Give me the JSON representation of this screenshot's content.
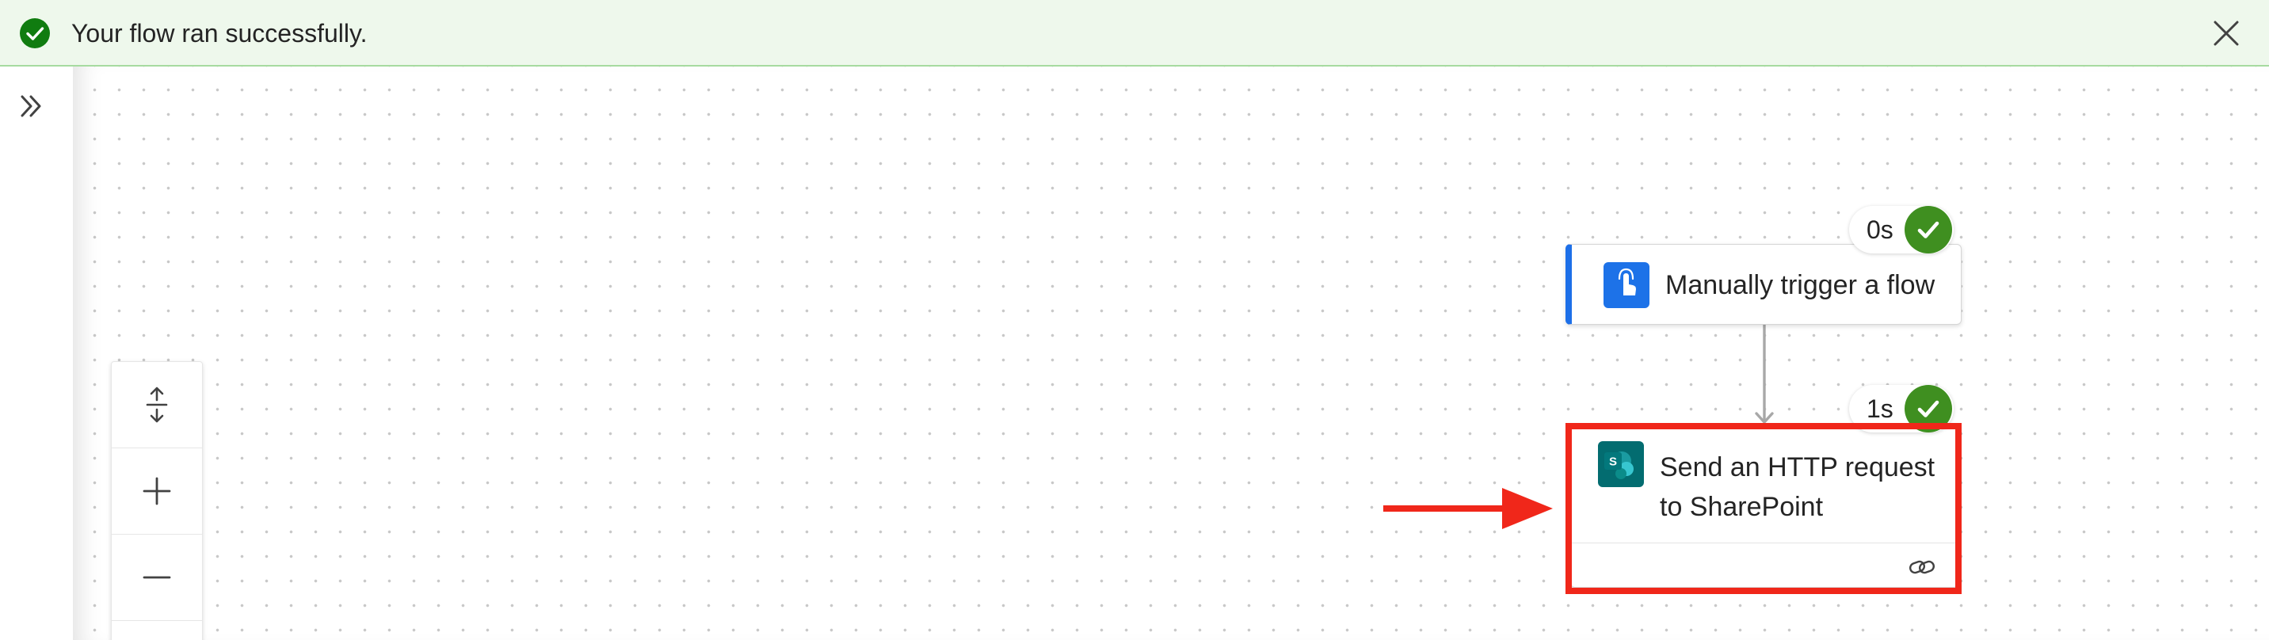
{
  "banner": {
    "message": "Your flow ran successfully.",
    "status_icon": "success-check-icon",
    "close_icon": "close-icon",
    "colors": {
      "background": "#eef8ec",
      "success": "#107c10"
    }
  },
  "rail": {
    "expand_icon": "double-chevron-right-icon"
  },
  "zoom": {
    "fit_icon": "fit-to-view-icon",
    "zoom_in_icon": "plus-icon",
    "zoom_out_icon": "minus-icon"
  },
  "flow": {
    "steps": [
      {
        "title": "Manually trigger a flow",
        "duration": "0s",
        "status": "succeeded",
        "icon": "touch-trigger-icon",
        "accent": "#1d6fe8"
      },
      {
        "title": "Send an HTTP request to SharePoint",
        "duration": "1s",
        "status": "succeeded",
        "icon": "sharepoint-icon",
        "icon_letter": "S",
        "footer_icon": "link-icon"
      }
    ]
  },
  "annotation": {
    "highlight_color": "#f0271a",
    "arrow": "right-arrow"
  }
}
